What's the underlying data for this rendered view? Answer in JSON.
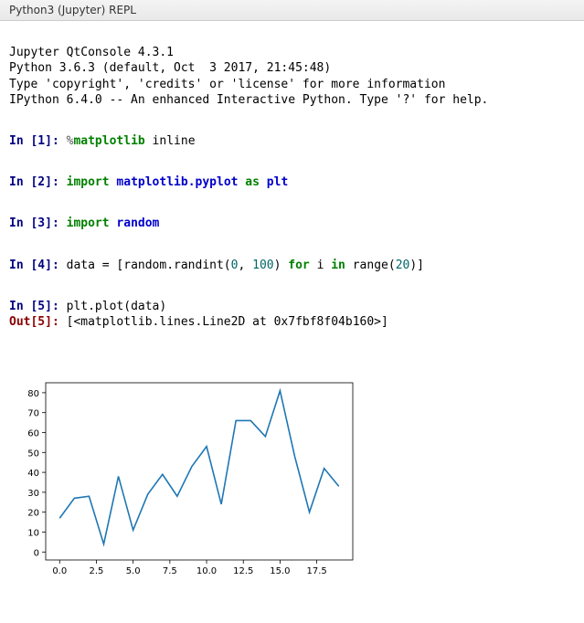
{
  "titlebar": "Python3 (Jupyter) REPL",
  "banner": {
    "line1": "Jupyter QtConsole 4.3.1",
    "line2": "Python 3.6.3 (default, Oct  3 2017, 21:45:48)",
    "line3": "Type 'copyright', 'credits' or 'license' for more information",
    "line4": "IPython 6.4.0 -- An enhanced Interactive Python. Type '?' for help."
  },
  "cells": {
    "c1": {
      "prompt": "In [1]: ",
      "magic_pct": "%",
      "magic_name": "matplotlib",
      "magic_arg": " inline"
    },
    "c2": {
      "prompt": "In [2]: ",
      "kw_import": "import ",
      "module": "matplotlib.pyplot",
      "kw_as": " as ",
      "alias": "plt"
    },
    "c3": {
      "prompt": "In [3]: ",
      "kw_import": "import ",
      "module": "random"
    },
    "c4": {
      "prompt": "In [4]: ",
      "t1": "data = [random.randint(",
      "n1": "0",
      "t2": ", ",
      "n2": "100",
      "t3": ") ",
      "kw_for": "for",
      "t4": " i ",
      "kw_in": "in",
      "t5": " range(",
      "n3": "20",
      "t6": ")]"
    },
    "c5": {
      "prompt": "In [5]: ",
      "code": "plt.plot(data)",
      "out_prompt": "Out[5]: ",
      "out_val": "[<matplotlib.lines.Line2D at 0x7fbf8f04b160>]"
    }
  },
  "chart_data": {
    "type": "line",
    "x": [
      0,
      1,
      2,
      3,
      4,
      5,
      6,
      7,
      8,
      9,
      10,
      11,
      12,
      13,
      14,
      15,
      16,
      17,
      18,
      19
    ],
    "values": [
      17,
      27,
      28,
      4,
      38,
      11,
      29,
      39,
      28,
      43,
      53,
      24,
      66,
      66,
      58,
      81,
      48,
      20,
      42,
      33
    ],
    "x_ticks": [
      "0.0",
      "2.5",
      "5.0",
      "7.5",
      "10.0",
      "12.5",
      "15.0",
      "17.5"
    ],
    "x_tick_vals": [
      0,
      2.5,
      5,
      7.5,
      10,
      12.5,
      15,
      17.5
    ],
    "y_ticks": [
      "0",
      "10",
      "20",
      "30",
      "40",
      "50",
      "60",
      "70",
      "80"
    ],
    "y_tick_vals": [
      0,
      10,
      20,
      30,
      40,
      50,
      60,
      70,
      80
    ],
    "xlim": [
      -0.95,
      19.95
    ],
    "ylim": [
      -4,
      85
    ],
    "line_color": "#1f77b4"
  }
}
